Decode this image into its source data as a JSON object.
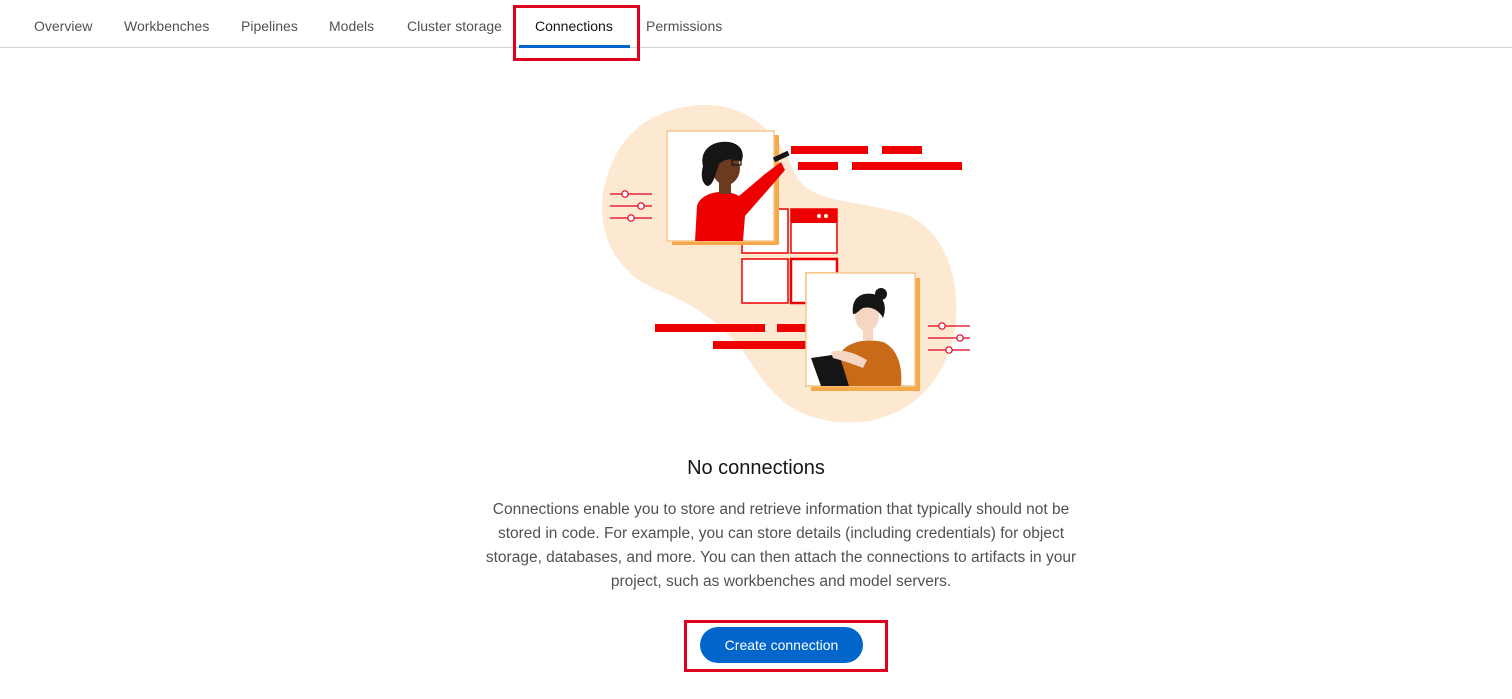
{
  "tabs": [
    {
      "label": "Overview",
      "active": false
    },
    {
      "label": "Workbenches",
      "active": false
    },
    {
      "label": "Pipelines",
      "active": false
    },
    {
      "label": "Models",
      "active": false
    },
    {
      "label": "Cluster storage",
      "active": false
    },
    {
      "label": "Connections",
      "active": true
    },
    {
      "label": "Permissions",
      "active": false
    }
  ],
  "empty_state": {
    "title": "No connections",
    "body": "Connections enable you to store and retrieve information that typically should not be stored in code. For example, you can store details (including credentials) for object storage, databases, and more. You can then attach the connections to artifacts in your project, such as workbenches and model servers.",
    "button_label": "Create connection"
  },
  "colors": {
    "accent": "#0066cc",
    "highlight": "#e00020",
    "illustration_red": "#ee0000",
    "illustration_peach": "#fde9d2",
    "illustration_orange": "#f5a94a"
  }
}
